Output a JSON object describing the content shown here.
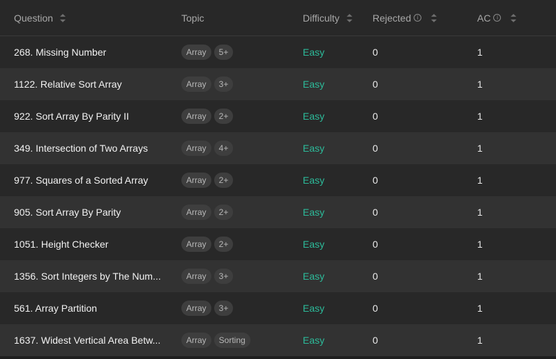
{
  "columns": {
    "question": "Question",
    "topic": "Topic",
    "difficulty": "Difficulty",
    "rejected": "Rejected",
    "ac": "AC"
  },
  "rows": [
    {
      "title": "268. Missing Number",
      "tag1": "Array",
      "tag2": "5+",
      "difficulty": "Easy",
      "rejected": "0",
      "ac": "1"
    },
    {
      "title": "1122. Relative Sort Array",
      "tag1": "Array",
      "tag2": "3+",
      "difficulty": "Easy",
      "rejected": "0",
      "ac": "1"
    },
    {
      "title": "922. Sort Array By Parity II",
      "tag1": "Array",
      "tag2": "2+",
      "difficulty": "Easy",
      "rejected": "0",
      "ac": "1"
    },
    {
      "title": "349. Intersection of Two Arrays",
      "tag1": "Array",
      "tag2": "4+",
      "difficulty": "Easy",
      "rejected": "0",
      "ac": "1"
    },
    {
      "title": "977. Squares of a Sorted Array",
      "tag1": "Array",
      "tag2": "2+",
      "difficulty": "Easy",
      "rejected": "0",
      "ac": "1"
    },
    {
      "title": "905. Sort Array By Parity",
      "tag1": "Array",
      "tag2": "2+",
      "difficulty": "Easy",
      "rejected": "0",
      "ac": "1"
    },
    {
      "title": "1051. Height Checker",
      "tag1": "Array",
      "tag2": "2+",
      "difficulty": "Easy",
      "rejected": "0",
      "ac": "1"
    },
    {
      "title": "1356. Sort Integers by The Num...",
      "tag1": "Array",
      "tag2": "3+",
      "difficulty": "Easy",
      "rejected": "0",
      "ac": "1"
    },
    {
      "title": "561. Array Partition",
      "tag1": "Array",
      "tag2": "3+",
      "difficulty": "Easy",
      "rejected": "0",
      "ac": "1"
    },
    {
      "title": "1637. Widest Vertical Area Betw...",
      "tag1": "Array",
      "tag2": "Sorting",
      "difficulty": "Easy",
      "rejected": "0",
      "ac": "1"
    }
  ],
  "colors": {
    "background": "#282828",
    "row_alt": "#323232",
    "easy": "#2cbb9a",
    "header_text": "#a8a8a8"
  },
  "icons": {
    "sort": "sort-updown-icon",
    "info": "info-icon"
  }
}
